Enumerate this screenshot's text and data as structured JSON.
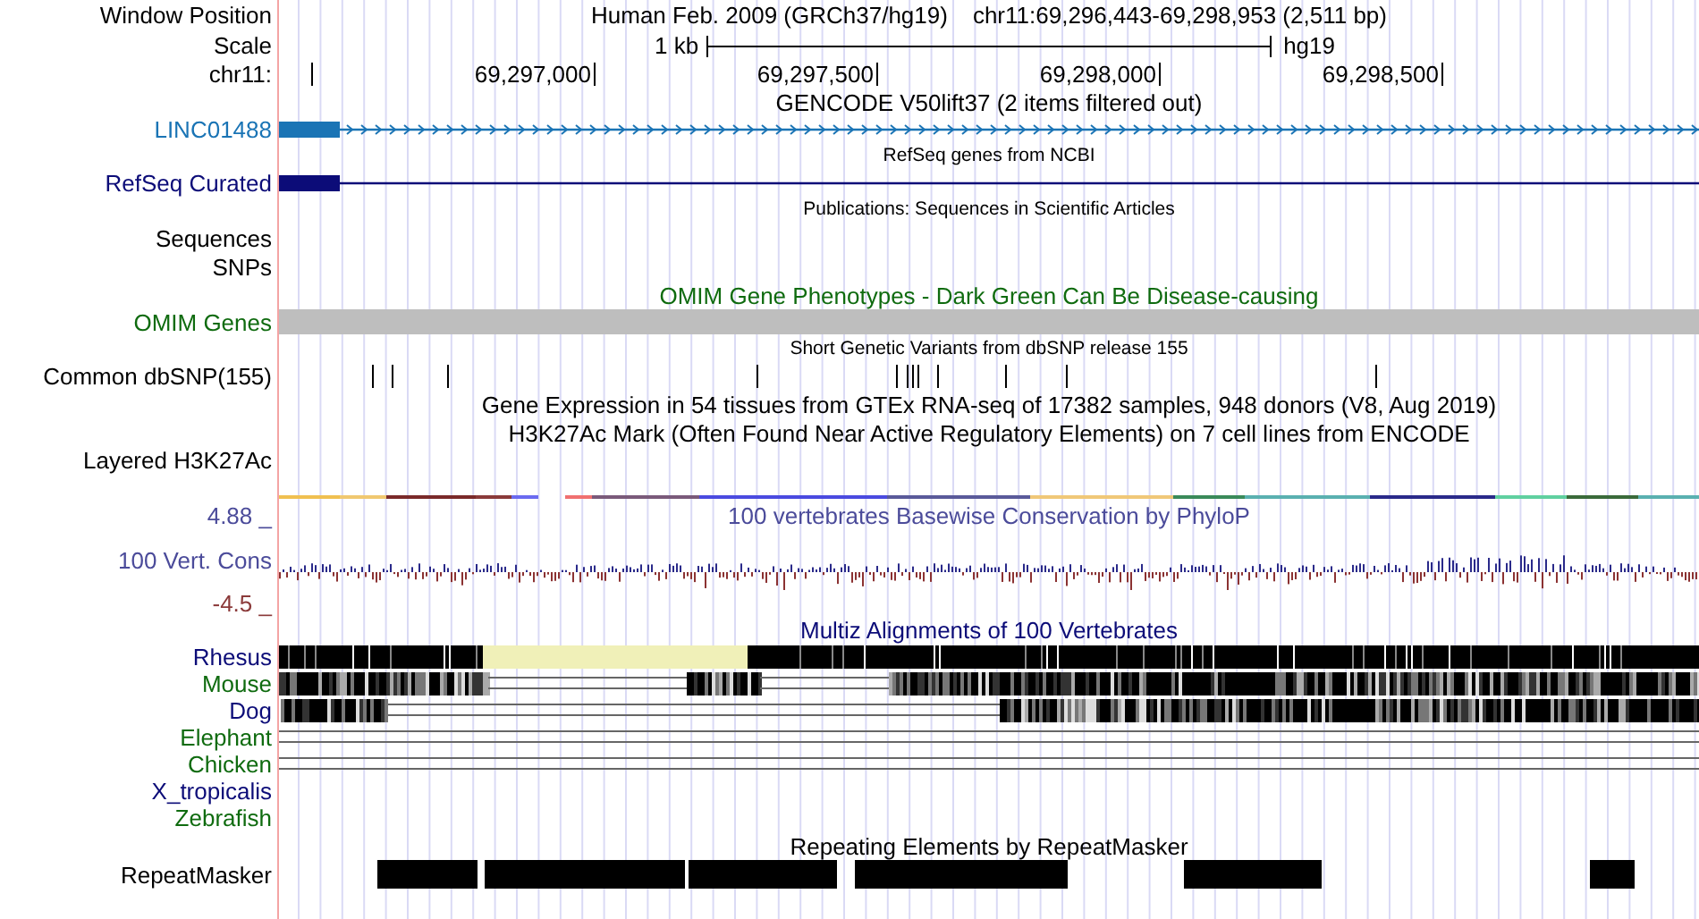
{
  "header": {
    "window_position_label": "Window Position",
    "assembly": "Human Feb. 2009 (GRCh37/hg19)",
    "position": "chr11:69,296,443-69,298,953 (2,511 bp)",
    "scale_label": "Scale",
    "scale_text": "1 kb",
    "scale_assembly": "hg19",
    "chrom_label": "chr11:",
    "ruler_ticks": [
      "69,297,000",
      "69,297,500",
      "69,298,000",
      "69,298,500"
    ]
  },
  "tracks": [
    {
      "kind": "gene",
      "title": "GENCODE V50lift37 (2 items filtered out)",
      "subtitle": false,
      "label": "LINC01488",
      "color": "#1a74b5",
      "strand_arrows": true
    },
    {
      "kind": "gene",
      "title": "RefSeq genes from NCBI",
      "subtitle": true,
      "label": "RefSeq Curated",
      "color": "#0c0c78",
      "strand_arrows": false
    },
    {
      "kind": "empty",
      "title": "Publications: Sequences in Scientific Articles",
      "subtitle": true,
      "label": "Sequences"
    },
    {
      "kind": "empty",
      "label": "SNPs"
    },
    {
      "kind": "bar",
      "title": "OMIM Gene Phenotypes - Dark Green Can Be Disease-causing",
      "subtitle": false,
      "label": "OMIM Genes",
      "color": "#0f6b0f"
    },
    {
      "kind": "ticks",
      "title": "Short Genetic Variants from dbSNP release 155",
      "subtitle": true,
      "label": "Common dbSNP(155)"
    },
    {
      "kind": "title_only",
      "title": "Gene Expression in 54 tissues from GTEx RNA-seq of 17382 samples, 948 donors (V8, Aug 2019)",
      "subtitle": false
    },
    {
      "kind": "layered",
      "title": "H3K27Ac Mark (Often Found Near Active Regulatory Elements) on 7 cell lines from ENCODE",
      "subtitle": false,
      "label": "Layered H3K27Ac"
    },
    {
      "kind": "wiggle",
      "title": "100 vertebrates Basewise Conservation by PhyloP",
      "label": "100 Vert. Cons",
      "color": "#4b4b9a",
      "max_label": "4.88 _",
      "min_label": "-4.5 _"
    },
    {
      "kind": "multiz",
      "title": "Multiz Alignments of 100 Vertebrates",
      "subtitle": false,
      "color": "#0c0c78",
      "species": [
        {
          "name": "Rhesus",
          "color": "#0c0c78"
        },
        {
          "name": "Mouse",
          "color": "#0f6b0f"
        },
        {
          "name": "Dog",
          "color": "#0c0c78"
        },
        {
          "name": "Elephant",
          "color": "#0f6b0f"
        },
        {
          "name": "Chicken",
          "color": "#0f6b0f"
        },
        {
          "name": "X_tropicalis",
          "color": "#0c0c78"
        },
        {
          "name": "Zebrafish",
          "color": "#0f6b0f"
        }
      ]
    },
    {
      "kind": "blocks",
      "title": "Repeating Elements by RepeatMasker",
      "subtitle": false,
      "label": "RepeatMasker"
    }
  ]
}
